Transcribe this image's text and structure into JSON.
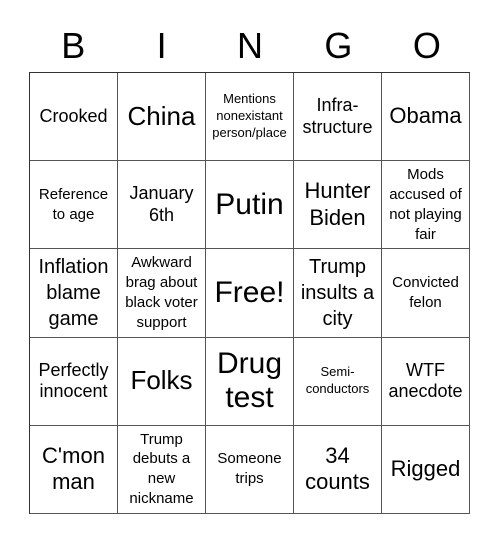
{
  "header": {
    "letters": [
      "B",
      "I",
      "N",
      "G",
      "O"
    ]
  },
  "cells": [
    "Crooked",
    "China",
    "Mentions nonexistant person/place",
    "Infra- structure",
    "Obama",
    "Reference to age",
    "January 6th",
    "Putin",
    "Hunter Biden",
    "Mods accused of not playing fair",
    "Inflation blame game",
    "Awkward brag about black voter support",
    "Free!",
    "Trump insults a city",
    "Convicted felon",
    "Perfectly innocent",
    "Folks",
    "Drug test",
    "Semi- conductors",
    "WTF anecdote",
    "C'mon man",
    "Trump debuts a new nickname",
    "Someone trips",
    "34 counts",
    "Rigged"
  ]
}
